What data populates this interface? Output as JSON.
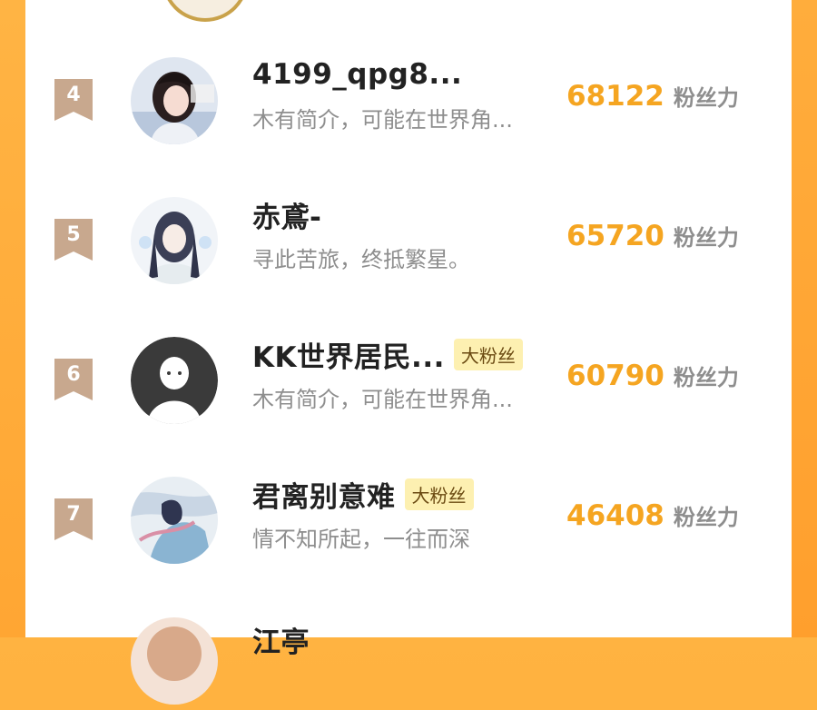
{
  "colors": {
    "accent_orange": "#f5a521",
    "rank_badge": "#c8a88e",
    "fan_badge_bg": "#fdf0b1"
  },
  "ranking": [
    {
      "rank": "4",
      "name": "4199_qpg8...",
      "badge": "",
      "bio": "木有简介，可能在世界角...",
      "score": "68122",
      "score_label": "粉丝力",
      "avatar_icon": "girl-portrait-avatar"
    },
    {
      "rank": "5",
      "name": "赤鳶-",
      "badge": "",
      "bio": "寻此苦旅，终抵繁星。",
      "score": "65720",
      "score_label": "粉丝力",
      "avatar_icon": "anime-character-avatar"
    },
    {
      "rank": "6",
      "name": "KK世界居民...",
      "badge": "大粉丝",
      "bio": "木有简介，可能在世界角...",
      "score": "60790",
      "score_label": "粉丝力",
      "avatar_icon": "default-user-avatar"
    },
    {
      "rank": "7",
      "name": "君离别意难",
      "badge": "大粉丝",
      "bio": "情不知所起，一往而深",
      "score": "46408",
      "score_label": "粉丝力",
      "avatar_icon": "painted-scene-avatar"
    },
    {
      "rank": "",
      "name": "江亭",
      "badge": "",
      "bio": "",
      "score": "",
      "score_label": "",
      "avatar_icon": "partial-avatar"
    }
  ]
}
